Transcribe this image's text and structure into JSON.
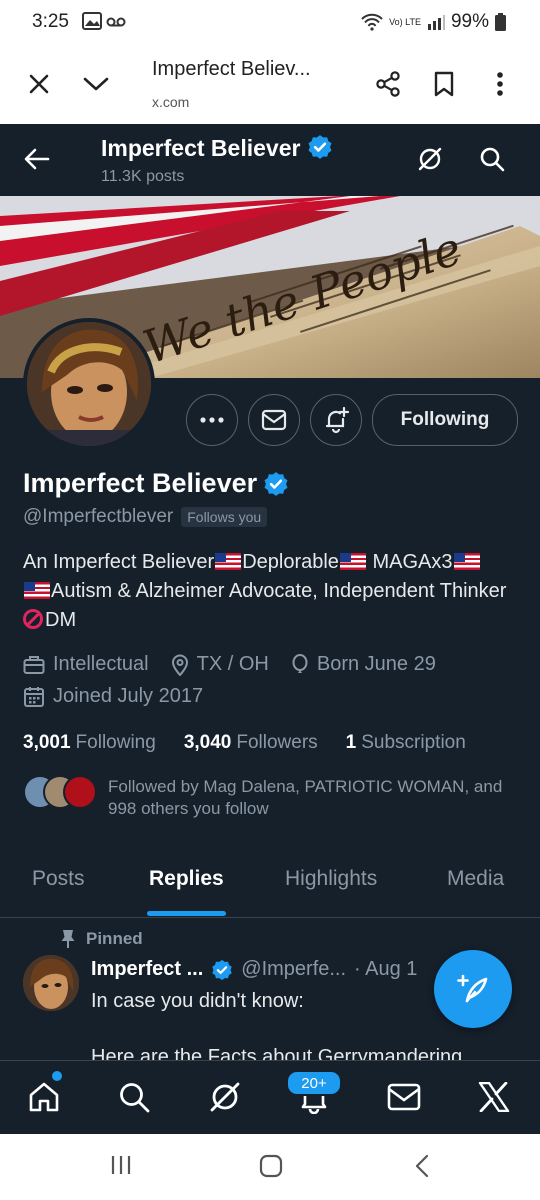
{
  "status_bar": {
    "time": "3:25",
    "battery": "99%",
    "network": "Vo) LTE"
  },
  "browser": {
    "title": "Imperfect Believ...",
    "url": "x.com"
  },
  "header": {
    "name": "Imperfect Believer",
    "posts": "11.3K posts"
  },
  "banner": {
    "text": "We the People"
  },
  "actions": {
    "follow_label": "Following"
  },
  "profile": {
    "name": "Imperfect Believer",
    "handle": "@Imperfectblever",
    "follows_you": "Follows you",
    "bio_1": "An Imperfect Believer",
    "bio_2": "Deplorable",
    "bio_3": " MAGAx3",
    "bio_4": "Autism & Alzheimer Advocate, Independent Thinker ",
    "bio_5": "DM",
    "category": "Intellectual",
    "location": "TX / OH",
    "birthday": "Born June 29",
    "joined": "Joined July 2017",
    "following_count": "3,001",
    "following_label": "Following",
    "followers_count": "3,040",
    "followers_label": "Followers",
    "subscription_count": "1",
    "subscription_label": "Subscription",
    "followed_by": "Followed by Mag Dalena, PATRIOTIC WOMAN, and 998 others you follow"
  },
  "tabs": [
    "Posts",
    "Replies",
    "Highlights",
    "Media"
  ],
  "active_tab": "Replies",
  "pinned_tweet": {
    "pinned_label": "Pinned",
    "name": "Imperfect ...",
    "handle": "@Imperfe...",
    "date": "· Aug 1",
    "text": "In case you didn't know:",
    "text2": "Here are the Facts about Gerrymandering"
  },
  "bottom_nav": {
    "notifications_badge": "20+"
  },
  "colors": {
    "background": "#15202b",
    "accent": "#1d9bf0",
    "muted": "#8b98a5"
  }
}
